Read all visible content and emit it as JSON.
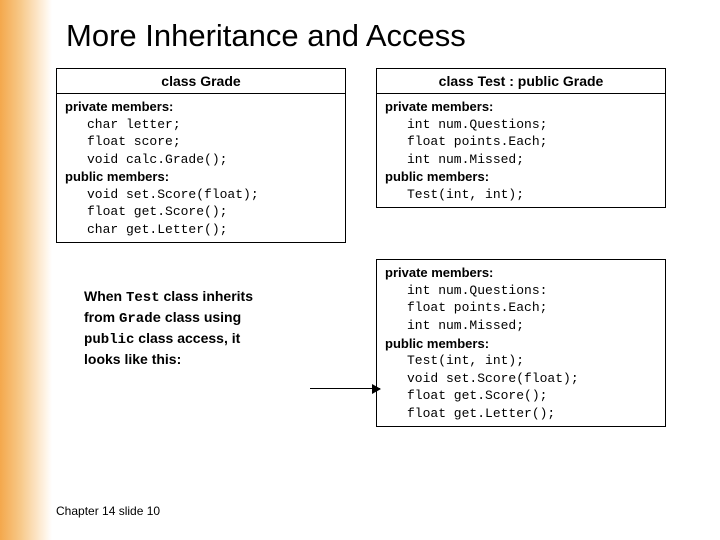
{
  "title": "More Inheritance and Access",
  "boxes": {
    "grade": {
      "header": "class Grade",
      "priv_label": "private members:",
      "priv": [
        "char letter;",
        "float score;",
        "void calc.Grade();"
      ],
      "pub_label": "public members:",
      "pub": [
        "void set.Score(float);",
        "float get.Score();",
        "char get.Letter();"
      ]
    },
    "test": {
      "header": "class Test : public Grade",
      "priv_label": "private members:",
      "priv": [
        "int num.Questions;",
        "float points.Each;",
        "int num.Missed;"
      ],
      "pub_label": "public members:",
      "pub": [
        "Test(int, int);"
      ]
    },
    "combined": {
      "priv_label": "private members:",
      "priv": [
        "int num.Questions:",
        "float points.Each;",
        "int num.Missed;"
      ],
      "pub_label": "public members:",
      "pub": [
        "Test(int, int);",
        "void set.Score(float);",
        "float get.Score();",
        "float get.Letter();"
      ]
    }
  },
  "explain": {
    "l1a": "When ",
    "l1c": "Test",
    "l1b": " class inherits",
    "l2a": "from ",
    "l2c": "Grade",
    "l2b": " class using",
    "l3c": "public",
    "l3b": " class access, it",
    "l4": "looks like this:"
  },
  "footer": "Chapter 14 slide 10"
}
